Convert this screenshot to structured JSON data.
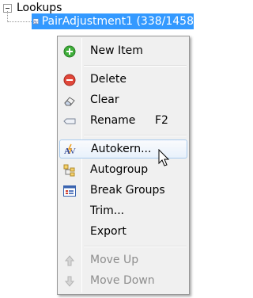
{
  "tree": {
    "root_label": "Lookups",
    "child_label": "PairAdjustment1 (338/1458"
  },
  "menu": {
    "items": [
      {
        "label": "New Item",
        "icon": "new-item-icon"
      },
      {
        "label": "Delete",
        "icon": "delete-icon"
      },
      {
        "label": "Clear",
        "icon": "eraser-icon"
      },
      {
        "label": "Rename",
        "shortcut": "F2",
        "icon": "rename-icon"
      },
      {
        "label": "Autokern...",
        "icon": "autokern-icon"
      },
      {
        "label": "Autogroup",
        "icon": "autogroup-icon"
      },
      {
        "label": "Break Groups",
        "icon": "break-groups-icon"
      },
      {
        "label": "Trim...",
        "icon": ""
      },
      {
        "label": "Export",
        "icon": ""
      },
      {
        "label": "Move Up",
        "icon": "arrow-up-icon",
        "disabled": true
      },
      {
        "label": "Move Down",
        "icon": "arrow-down-icon",
        "disabled": true
      }
    ],
    "highlighted": "Autokern..."
  },
  "colors": {
    "selection": "#3399ff",
    "menu_bg": "#f0f0f0",
    "disabled_text": "#8d8d8d"
  }
}
